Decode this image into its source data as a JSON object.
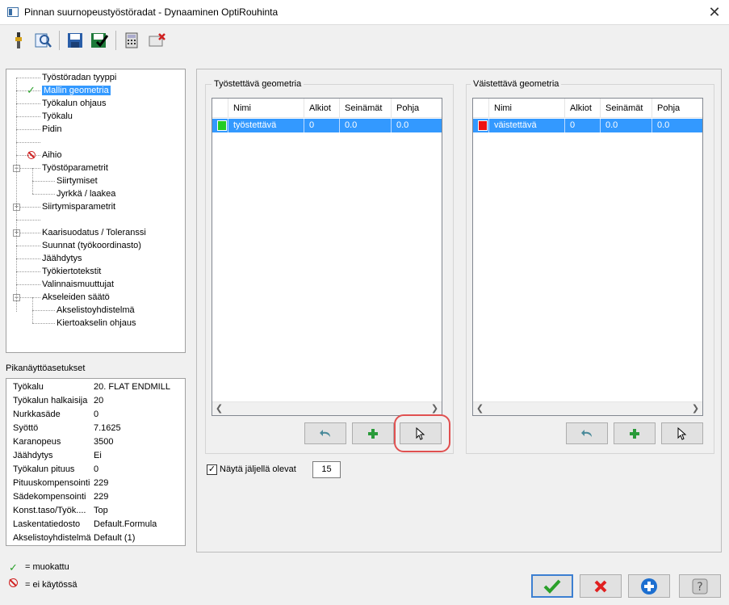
{
  "window": {
    "title": "Pinnan suurnopeustyöstöradat - Dynaaminen OptiRouhinta",
    "close_symbol": "✕"
  },
  "toolbar": {
    "icons": [
      "tool-icon",
      "magnify-file-icon",
      "save-icon",
      "save-check-icon",
      "calculator-icon",
      "delete-icon"
    ]
  },
  "tree": {
    "items": [
      {
        "label": "Työstöradan tyyppi"
      },
      {
        "label": "Mallin geometria",
        "modified": true,
        "selected": true
      },
      {
        "label": "Työkalun ohjaus"
      },
      {
        "label": "Työkalu"
      },
      {
        "label": "Pidin"
      },
      {
        "label": ""
      },
      {
        "label": "Aihio",
        "disabled": true
      },
      {
        "label": "Työstöparametrit",
        "expander": "−"
      },
      {
        "label": "Siirtymiset"
      },
      {
        "label": "Jyrkkä / laakea"
      },
      {
        "label": "Siirtymisparametrit",
        "expander": "+"
      },
      {
        "label": ""
      },
      {
        "label": "Kaarisuodatus / Toleranssi",
        "expander": "+"
      },
      {
        "label": "Suunnat (työkoordinasto)"
      },
      {
        "label": "Jäähdytys"
      },
      {
        "label": "Työkiertotekstit"
      },
      {
        "label": "Valinnaismuuttujat"
      },
      {
        "label": "Akseleiden säätö",
        "expander": "−"
      },
      {
        "label": "Akselistoyhdistelmä"
      },
      {
        "label": "Kiertoakselin ohjaus"
      }
    ]
  },
  "quickview": {
    "title": "Pikanäyttöasetukset",
    "rows": [
      {
        "key": "Työkalu",
        "value": "20. FLAT ENDMILL"
      },
      {
        "key": "Työkalun halkaisija",
        "value": "20"
      },
      {
        "key": "Nurkkasäde",
        "value": "0"
      },
      {
        "key": "Syöttö",
        "value": "7.1625"
      },
      {
        "key": "Karanopeus",
        "value": "3500"
      },
      {
        "key": "Jäähdytys",
        "value": "Ei"
      },
      {
        "key": "Työkalun pituus",
        "value": "0"
      },
      {
        "key": "Pituuskompensointi",
        "value": "229"
      },
      {
        "key": "Sädekompensointi",
        "value": "229"
      },
      {
        "key": "Konst.taso/Työk....",
        "value": "Top"
      },
      {
        "key": "Laskentatiedosto",
        "value": "Default.Formula"
      },
      {
        "key": "Akselistoyhdistelmä",
        "value": "Default (1)"
      }
    ]
  },
  "legend": {
    "modified_icon": "✓",
    "modified": "= muokattu",
    "disabled": "= ei käytössä"
  },
  "machined": {
    "title": "Työstettävä geometria",
    "columns": [
      "Nimi",
      "Alkiot",
      "Seinämät",
      "Pohja"
    ],
    "rows": [
      {
        "color": "#22cc22",
        "name": "työstettävä",
        "alkiot": "0",
        "seinamat": "0.0",
        "pohja": "0.0"
      }
    ]
  },
  "avoid": {
    "title": "Väistettävä geometria",
    "columns": [
      "Nimi",
      "Alkiot",
      "Seinämät",
      "Pohja"
    ],
    "rows": [
      {
        "color": "#ee1111",
        "name": "väistettävä",
        "alkiot": "0",
        "seinamat": "0.0",
        "pohja": "0.0"
      }
    ]
  },
  "scroll": {
    "left": "❮",
    "right": "❯"
  },
  "show_remaining": {
    "label": "Näytä jäljellä olevat",
    "checked": true,
    "check_symbol": "✓",
    "value": "15"
  },
  "colors": {
    "selection": "#3399ff",
    "ok_border": "#3c7fd1",
    "highlight": "#e05050"
  }
}
